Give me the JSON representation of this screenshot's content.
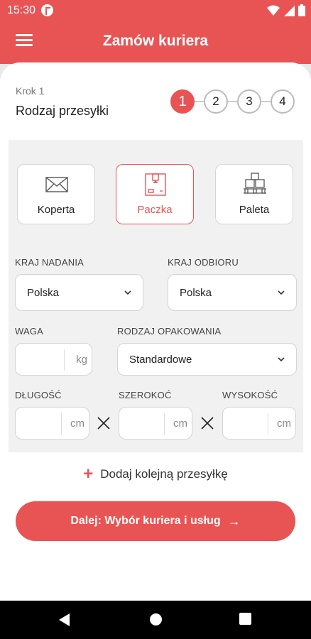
{
  "status_bar": {
    "time": "15:30"
  },
  "header": {
    "title": "Zamów kuriera"
  },
  "step": {
    "label": "Krok 1",
    "title": "Rodzaj przesyłki",
    "steps": [
      "1",
      "2",
      "3",
      "4"
    ],
    "active_index": 0
  },
  "shipment_types": [
    {
      "label": "Koperta",
      "icon": "envelope-icon",
      "selected": false
    },
    {
      "label": "Paczka",
      "icon": "package-box-icon",
      "selected": true
    },
    {
      "label": "Paleta",
      "icon": "pallet-icon",
      "selected": false
    }
  ],
  "form": {
    "origin_country": {
      "label": "KRAJ NADANIA",
      "value": "Polska"
    },
    "destination_country": {
      "label": "KRAJ ODBIORU",
      "value": "Polska"
    },
    "weight": {
      "label": "WAGA",
      "value": "",
      "unit": "kg"
    },
    "packaging": {
      "label": "RODZAJ OPAKOWANIA",
      "value": "Standardowe"
    },
    "length": {
      "label": "DŁUGOŚĆ",
      "value": "",
      "unit": "cm"
    },
    "width": {
      "label": "SZEROKOĆ",
      "value": "",
      "unit": "cm"
    },
    "height": {
      "label": "WYSOKOŚĆ",
      "value": "",
      "unit": "cm"
    }
  },
  "add_shipment": {
    "label": "Dodaj kolejną przesyłkę"
  },
  "next_button": {
    "label": "Dalej: Wybór kuriera i usług"
  },
  "colors": {
    "accent": "#e85454",
    "panel": "#f1f1f1",
    "border": "#d4d4d4"
  }
}
